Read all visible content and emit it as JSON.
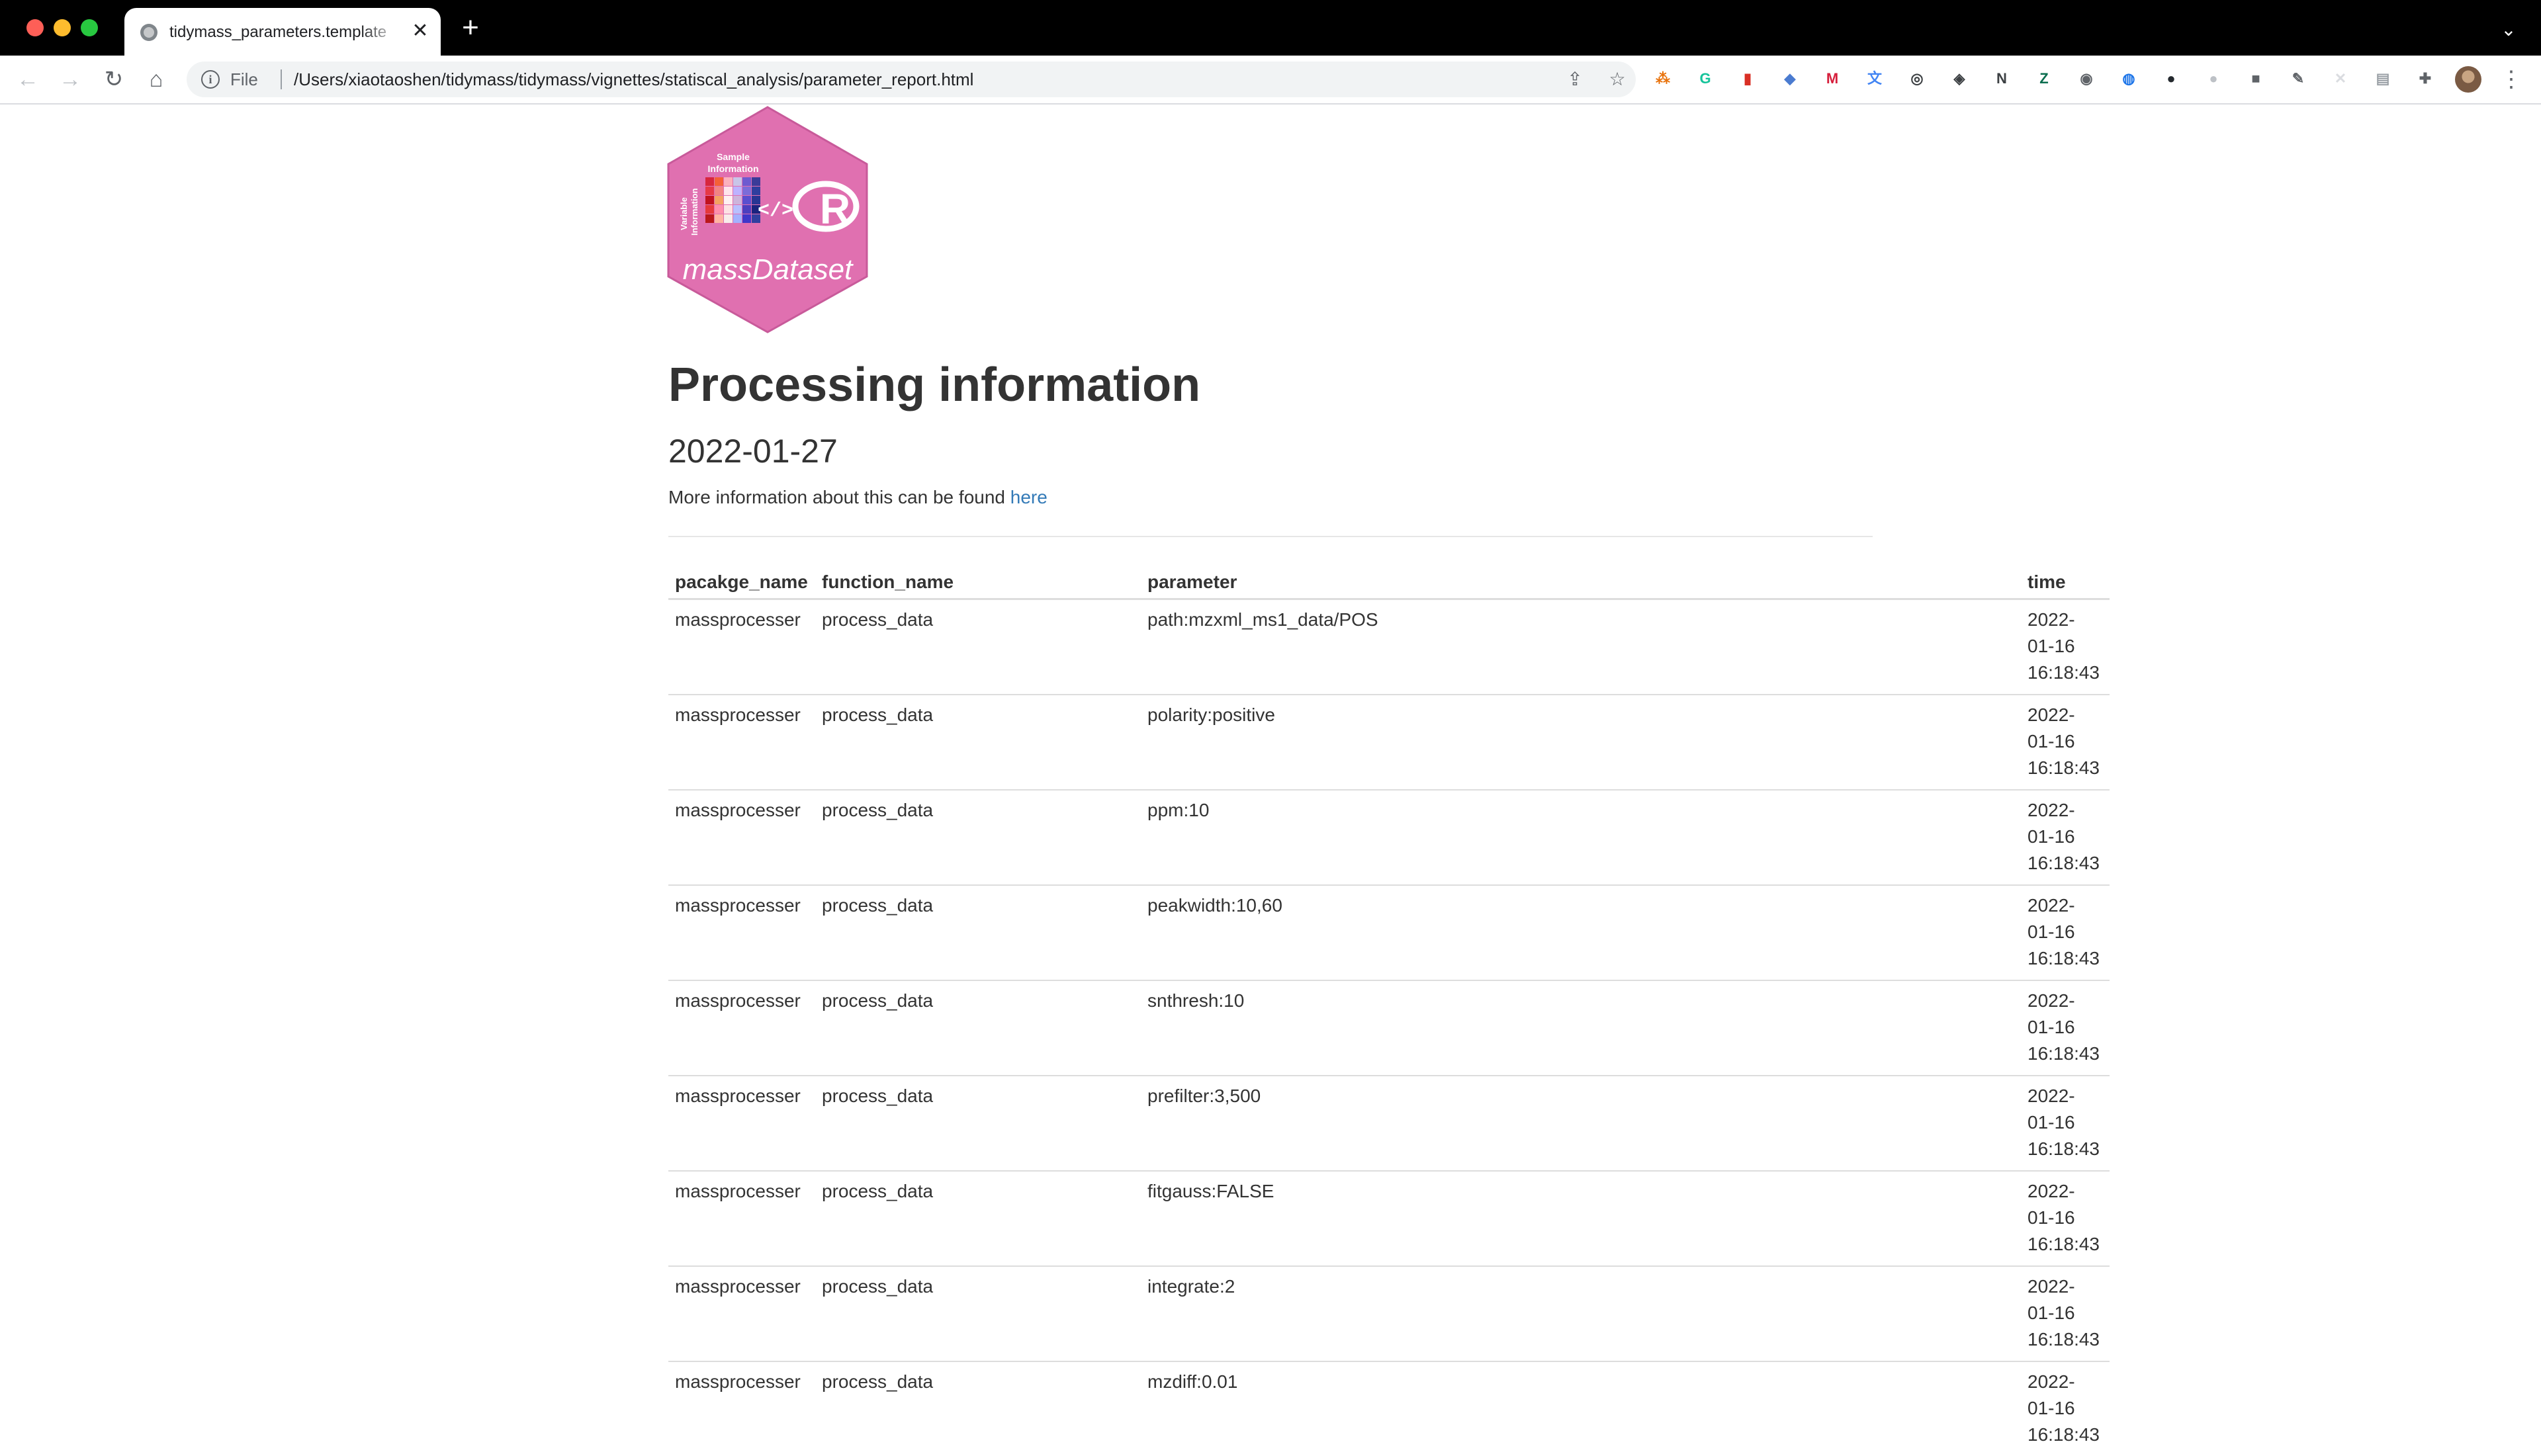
{
  "browser": {
    "tab_title": "tidymass_parameters.template",
    "tab_close": "✕",
    "new_tab": "+",
    "tab_menu": "⌄",
    "nav": {
      "back": "←",
      "forward": "→",
      "reload": "↻",
      "home": "⌂"
    },
    "address": {
      "scheme_label": "File",
      "url": "/Users/xiaotaoshen/tidymass/tidymass/vignettes/statiscal_analysis/parameter_report.html",
      "share_icon": "⇪",
      "bookmark_icon": "☆"
    },
    "more_menu": "⋮"
  },
  "extensions": [
    {
      "name": "hierarchy-extension-icon",
      "glyph": "⁂",
      "color": "#e8710a"
    },
    {
      "name": "grammarly-icon",
      "glyph": "G",
      "color": "#15c39a"
    },
    {
      "name": "red-book-extension-icon",
      "glyph": "▮",
      "color": "#d93025"
    },
    {
      "name": "zotero-connector-icon",
      "glyph": "◆",
      "color": "#4a7bd0"
    },
    {
      "name": "mendeley-icon",
      "glyph": "M",
      "color": "#d61f3c"
    },
    {
      "name": "google-translate-icon",
      "glyph": "文",
      "color": "#4285f4"
    },
    {
      "name": "search-translate-icon",
      "glyph": "◎",
      "color": "#3c4043"
    },
    {
      "name": "fox-extension-icon",
      "glyph": "◈",
      "color": "#3c4043"
    },
    {
      "name": "notion-web-clipper-icon",
      "glyph": "N",
      "color": "#3c4043"
    },
    {
      "name": "green-z-extension-icon",
      "glyph": "Z",
      "color": "#0b6e4f"
    },
    {
      "name": "lens-extension-icon",
      "glyph": "◉",
      "color": "#5f6368"
    },
    {
      "name": "blue-drop-extension-icon",
      "glyph": "◍",
      "color": "#1a73e8"
    },
    {
      "name": "github-extension-icon",
      "glyph": "●",
      "color": "#24292e"
    },
    {
      "name": "gray-circle-extension-icon",
      "glyph": "●",
      "color": "#bdc1c6"
    },
    {
      "name": "gray-square-extension-icon",
      "glyph": "■",
      "color": "#5f6368"
    },
    {
      "name": "pen-extension-icon",
      "glyph": "✎",
      "color": "#5f6368"
    },
    {
      "name": "x-extension-icon",
      "glyph": "✕",
      "color": "#dadce0"
    },
    {
      "name": "document-extension-icon",
      "glyph": "▤",
      "color": "#9aa0a6"
    },
    {
      "name": "extensions-puzzle-icon",
      "glyph": "✚",
      "color": "#5f6368"
    }
  ],
  "logo": {
    "header": "Sample Information",
    "header_line1": "Sample",
    "header_line2": "Information",
    "side_label": "Variable Information",
    "side_line1": "Variable",
    "side_line2": "Information",
    "code_symbol": "</>",
    "r_letter": "R",
    "name": "massDataset",
    "colors": {
      "hex_fill": "#e070b0",
      "hex_border": "#c85a9a"
    }
  },
  "page": {
    "title": "Processing information",
    "date": "2022-01-27",
    "more_info_text": "More information about this can be found",
    "more_info_link": "here"
  },
  "table": {
    "headers": [
      "pacakge_name",
      "function_name",
      "parameter",
      "time"
    ],
    "rows": [
      {
        "package": "massprocesser",
        "function": "process_data",
        "parameter": "path:mzxml_ms1_data/POS",
        "time1": "2022-",
        "time2": "01-16",
        "time3": "16:18:43"
      },
      {
        "package": "massprocesser",
        "function": "process_data",
        "parameter": "polarity:positive",
        "time1": "2022-",
        "time2": "01-16",
        "time3": "16:18:43"
      },
      {
        "package": "massprocesser",
        "function": "process_data",
        "parameter": "ppm:10",
        "time1": "2022-",
        "time2": "01-16",
        "time3": "16:18:43"
      },
      {
        "package": "massprocesser",
        "function": "process_data",
        "parameter": "peakwidth:10,60",
        "time1": "2022-",
        "time2": "01-16",
        "time3": "16:18:43"
      },
      {
        "package": "massprocesser",
        "function": "process_data",
        "parameter": "snthresh:10",
        "time1": "2022-",
        "time2": "01-16",
        "time3": "16:18:43"
      },
      {
        "package": "massprocesser",
        "function": "process_data",
        "parameter": "prefilter:3,500",
        "time1": "2022-",
        "time2": "01-16",
        "time3": "16:18:43"
      },
      {
        "package": "massprocesser",
        "function": "process_data",
        "parameter": "fitgauss:FALSE",
        "time1": "2022-",
        "time2": "01-16",
        "time3": "16:18:43"
      },
      {
        "package": "massprocesser",
        "function": "process_data",
        "parameter": "integrate:2",
        "time1": "2022-",
        "time2": "01-16",
        "time3": "16:18:43"
      },
      {
        "package": "massprocesser",
        "function": "process_data",
        "parameter": "mzdiff:0.01",
        "time1": "2022-",
        "time2": "01-16",
        "time3": "16:18:43"
      }
    ]
  },
  "colors": {
    "text": "#333333",
    "link": "#337ab7",
    "rule": "#dddddd",
    "chrome_dark": "#000000"
  }
}
